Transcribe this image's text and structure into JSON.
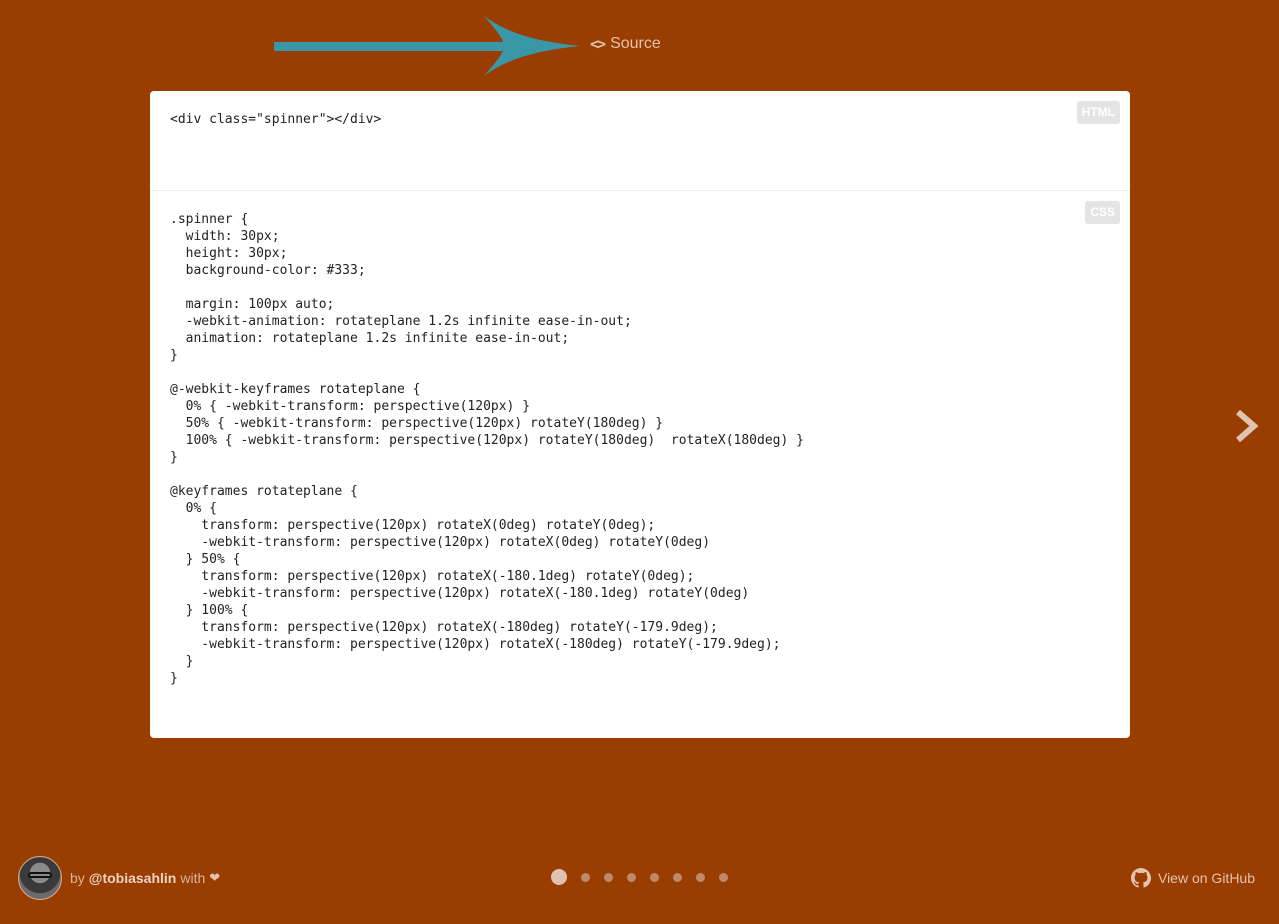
{
  "header": {
    "source_icon": "code-brackets-icon",
    "source_label": "Source"
  },
  "code_panel": {
    "html_badge": "HTML",
    "html_code": "<div class=\"spinner\"></div>",
    "css_badge": "CSS",
    "css_code": ".spinner {\n  width: 30px;\n  height: 30px;\n  background-color: #333;\n\n  margin: 100px auto;\n  -webkit-animation: rotateplane 1.2s infinite ease-in-out;\n  animation: rotateplane 1.2s infinite ease-in-out;\n}\n\n@-webkit-keyframes rotateplane {\n  0% { -webkit-transform: perspective(120px) }\n  50% { -webkit-transform: perspective(120px) rotateY(180deg) }\n  100% { -webkit-transform: perspective(120px) rotateY(180deg)  rotateX(180deg) }\n}\n\n@keyframes rotateplane {\n  0% {\n    transform: perspective(120px) rotateX(0deg) rotateY(0deg);\n    -webkit-transform: perspective(120px) rotateX(0deg) rotateY(0deg)\n  } 50% {\n    transform: perspective(120px) rotateX(-180.1deg) rotateY(0deg);\n    -webkit-transform: perspective(120px) rotateX(-180.1deg) rotateY(0deg)\n  } 100% {\n    transform: perspective(120px) rotateX(-180deg) rotateY(-179.9deg);\n    -webkit-transform: perspective(120px) rotateX(-180deg) rotateY(-179.9deg);\n  }\n}"
  },
  "nav": {
    "next_icon": "chevron-right-icon",
    "page_count": 8,
    "active_page": 1
  },
  "footer": {
    "by_text": "by",
    "handle": "@tobiasahlin",
    "with_text": "with",
    "heart": "❤",
    "github_icon": "github-icon",
    "github_label": "View on GitHub"
  },
  "colors": {
    "background": "#993d00",
    "annotation_arrow": "#3a98a6",
    "panel": "#ffffff"
  }
}
